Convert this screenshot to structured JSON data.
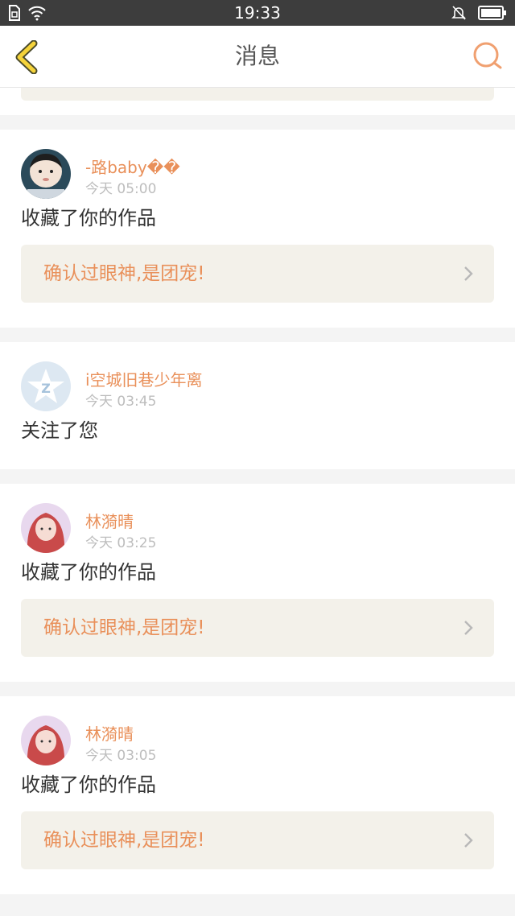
{
  "status_bar": {
    "time": "19:33"
  },
  "header": {
    "title": "消息"
  },
  "colors": {
    "accent": "#e9905a",
    "back_yellow": "#f5d33a",
    "quote_bg": "#f3f1ea"
  },
  "messages": [
    {
      "user": "-路baby��",
      "time": "今天 05:00",
      "action": "收藏了你的作品",
      "work_title": "确认过眼神,是团宠!",
      "avatar": "photo-boy"
    },
    {
      "user": "i空城旧巷少年离",
      "time": "今天 03:45",
      "action": "关注了您",
      "avatar": "qzone-default"
    },
    {
      "user": "林漪晴",
      "time": "今天 03:25",
      "action": "收藏了你的作品",
      "work_title": "确认过眼神,是团宠!",
      "avatar": "photo-girl"
    },
    {
      "user": "林漪晴",
      "time": "今天 03:05",
      "action": "收藏了你的作品",
      "work_title": "确认过眼神,是团宠!",
      "avatar": "photo-girl"
    }
  ]
}
